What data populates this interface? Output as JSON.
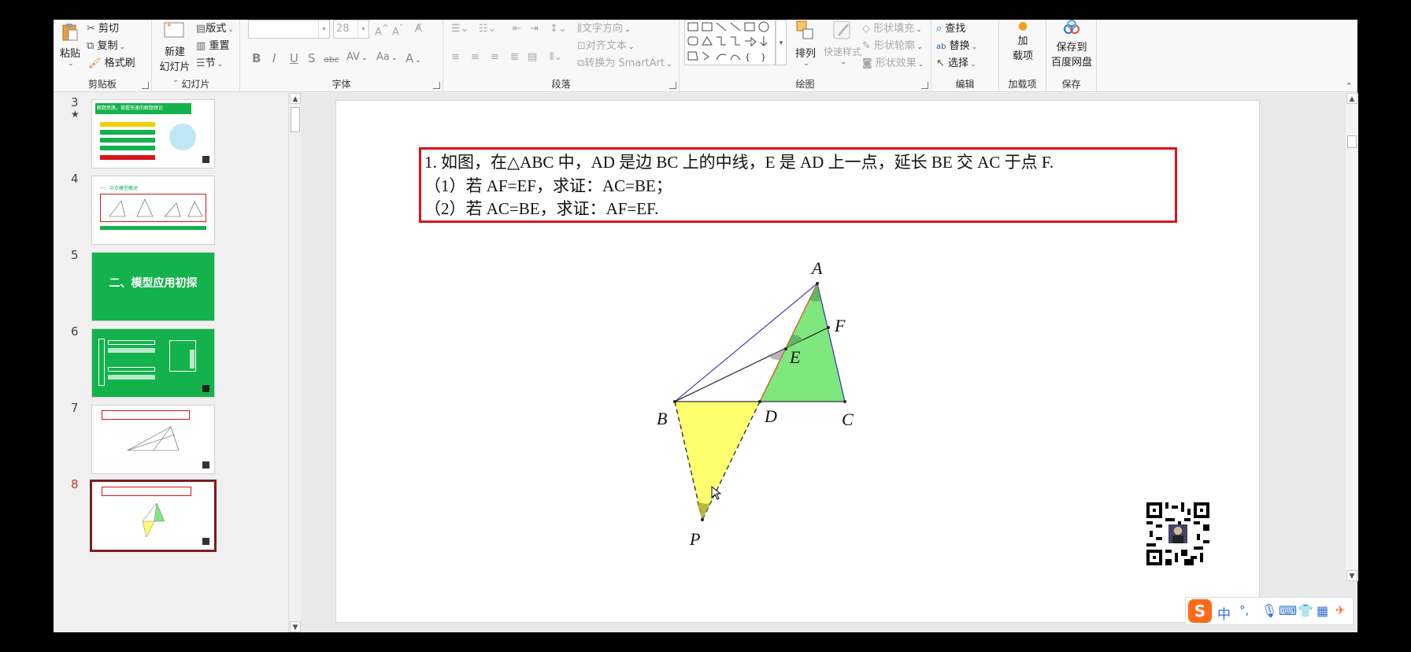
{
  "ribbon": {
    "clipboard": {
      "paste": "粘贴",
      "cut": "剪切",
      "copy": "复制",
      "format_painter": "格式刷",
      "label": "剪贴板"
    },
    "slides": {
      "new_slide_1": "新建",
      "new_slide_2": "幻灯片",
      "layout": "版式",
      "reset": "重置",
      "section": "节",
      "label": "幻灯片"
    },
    "font": {
      "size": "28",
      "label": "字体",
      "bold": "B",
      "italic": "I",
      "underline": "U",
      "shadow": "S",
      "strike": "abc",
      "spacing": "AV",
      "case": "Aa",
      "color": "A"
    },
    "paragraph": {
      "text_direction": "文字方向",
      "align_text": "对齐文本",
      "smartart": "转换为 SmartArt",
      "label": "段落"
    },
    "drawing": {
      "arrange": "排列",
      "quick_styles": "快速样式",
      "shape_fill": "形状填充",
      "shape_outline": "形状轮廓",
      "shape_effects": "形状效果",
      "label": "绘图"
    },
    "editing": {
      "find": "查找",
      "replace": "替换",
      "select": "选择",
      "label": "编辑"
    },
    "addins": {
      "add_1": "加",
      "add_2": "载项",
      "label": "加载项"
    },
    "save": {
      "save_1": "保存到",
      "save_2": "百度网盘",
      "label": "保存"
    }
  },
  "thumbnails": [
    {
      "num": "3",
      "star": "★",
      "title": "解题思路，掌握快速的解题理论"
    },
    {
      "num": "4",
      "title": "一、中点模型概述"
    },
    {
      "num": "5",
      "title": "二、模型应用初探"
    },
    {
      "num": "6"
    },
    {
      "num": "7"
    },
    {
      "num": "8",
      "current": true
    }
  ],
  "problem": {
    "line1": "1. 如图，在△ABC 中，AD 是边 BC 上的中线，E 是 AD 上一点，延长 BE 交 AC 于点 F.",
    "line2": "（1）若 AF=EF，求证：AC=BE；",
    "line3": "（2）若 AC=BE，求证：AF=EF."
  },
  "figure": {
    "labels": {
      "A": "A",
      "B": "B",
      "C": "C",
      "D": "D",
      "E": "E",
      "F": "F",
      "P": "P"
    }
  },
  "ime": {
    "lang": "中",
    "punct": "°,"
  },
  "colors": {
    "green_fill": "#7ee77e",
    "yellow_fill": "#ffff6e",
    "red_border": "#d9141a",
    "slide_green": "#14b24c"
  }
}
